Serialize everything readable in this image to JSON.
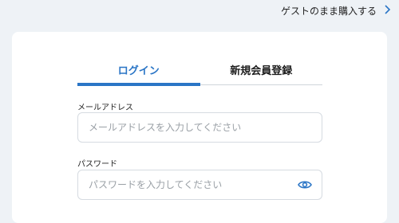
{
  "guest_link": {
    "label": "ゲストのまま購入する"
  },
  "tabs": [
    {
      "label": "ログイン",
      "active": true
    },
    {
      "label": "新規会員登録",
      "active": false
    }
  ],
  "form": {
    "email": {
      "label": "メールアドレス",
      "placeholder": "メールアドレスを入力してください",
      "value": ""
    },
    "password": {
      "label": "パスワード",
      "placeholder": "パスワードを入力してください",
      "value": ""
    }
  },
  "icons": {
    "guest_arrow": "chevron-right-icon",
    "password_toggle": "eye-icon"
  },
  "colors": {
    "accent": "#2a75c6",
    "background": "#eef2f6",
    "card": "#ffffff"
  }
}
